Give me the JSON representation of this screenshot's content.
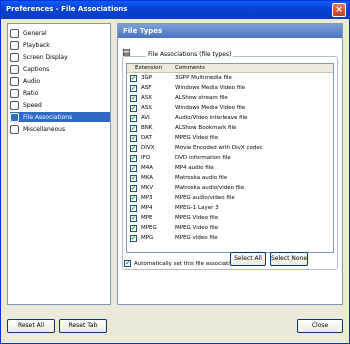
{
  "window": {
    "title": "Preferences - File Associations",
    "close_glyph": "×"
  },
  "sidebar": {
    "items": [
      {
        "label": "General"
      },
      {
        "label": "Playback"
      },
      {
        "label": "Screen Display"
      },
      {
        "label": "Captions"
      },
      {
        "label": "Audio"
      },
      {
        "label": "Ratio"
      },
      {
        "label": "Speed"
      },
      {
        "label": "File Associations",
        "selected": true
      },
      {
        "label": "Miscellaneous"
      }
    ]
  },
  "panel": {
    "title": "File Types",
    "group_label": "File Associations (file types)",
    "columns": {
      "extension": "Extension",
      "comments": "Comments"
    },
    "rows": [
      {
        "ext": "3GP",
        "desc": "3GPP Multimedia file"
      },
      {
        "ext": "ASF",
        "desc": "Windows Media Video file"
      },
      {
        "ext": "ASX",
        "desc": "ALShow stream file"
      },
      {
        "ext": "ASX",
        "desc": "Windows Media Video file"
      },
      {
        "ext": "AVI",
        "desc": "Audio/Video interleave file"
      },
      {
        "ext": "BNK",
        "desc": "ALShow Bookmark file"
      },
      {
        "ext": "DAT",
        "desc": "MPEG Video file"
      },
      {
        "ext": "DIVX",
        "desc": "Movie Encoded with DivX codec"
      },
      {
        "ext": "IFO",
        "desc": "DVD information file"
      },
      {
        "ext": "M4A",
        "desc": "MP4 audio file"
      },
      {
        "ext": "MKA",
        "desc": "Matroska audio file"
      },
      {
        "ext": "MKV",
        "desc": "Matroska audio/video file"
      },
      {
        "ext": "MP3",
        "desc": "MPEG audio/video file"
      },
      {
        "ext": "MP4",
        "desc": "MPEG-1 Layer 3"
      },
      {
        "ext": "MPE",
        "desc": "MPEG Video file"
      },
      {
        "ext": "MPEG",
        "desc": "MPEG Video file"
      },
      {
        "ext": "MPG",
        "desc": "MPEG video file"
      }
    ],
    "auto_label": "Automatically set this file association",
    "select_all": "Select All",
    "select_none": "Select None"
  },
  "footer": {
    "reset_all": "Reset All",
    "reset_tab": "Reset Tab",
    "close": "Close"
  },
  "check_glyph": "✔"
}
